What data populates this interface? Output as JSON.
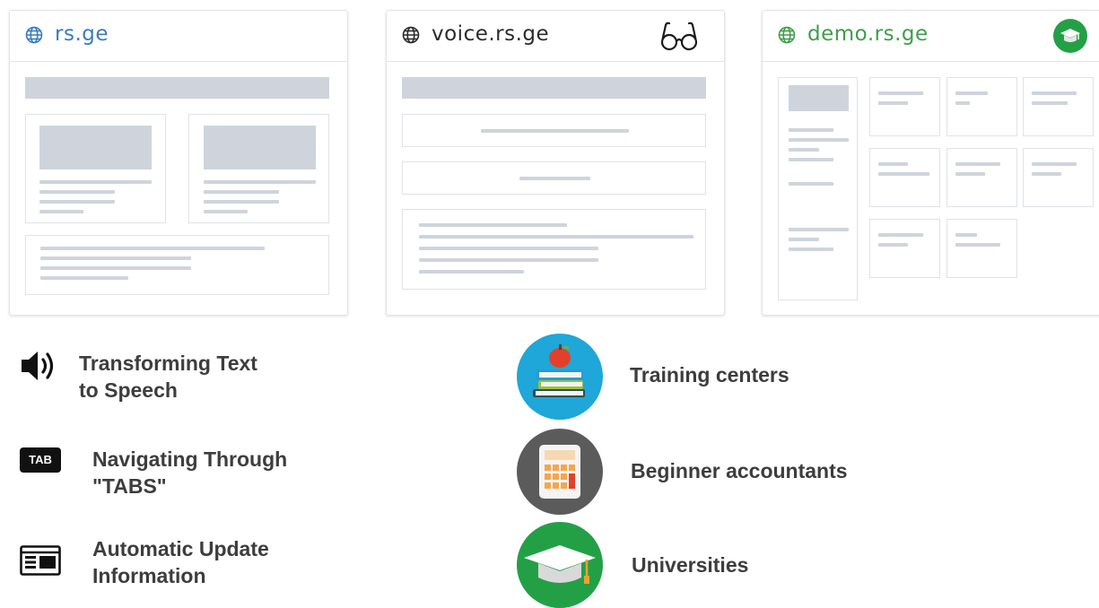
{
  "cards": [
    {
      "title": "rs.ge",
      "color": "#3a7bbf"
    },
    {
      "title": "voice.rs.ge",
      "color": "#2b2b2b"
    },
    {
      "title": "demo.rs.ge",
      "color": "#3f9d4a"
    }
  ],
  "features": {
    "speech": {
      "line1": "Transforming Text",
      "line2": "to Speech"
    },
    "tabs": {
      "line1": "Navigating Through",
      "line2": "\"TABS\"",
      "key_label": "TAB"
    },
    "update": {
      "line1": "Automatic Update",
      "line2": "Information"
    }
  },
  "audiences": {
    "training": "Training centers",
    "accountants": "Beginner accountants",
    "universities": "Universities"
  },
  "colors": {
    "wireframe": "#cfd4dc",
    "training_bg": "#1ea7d8",
    "accountants_bg": "#5b5b5b",
    "universities_bg": "#23a046"
  },
  "icons": [
    "globe-icon",
    "glasses-icon",
    "graduation-cap-icon",
    "speaker-icon",
    "tab-key-icon",
    "news-window-icon",
    "books-apple-icon",
    "calculator-icon"
  ]
}
